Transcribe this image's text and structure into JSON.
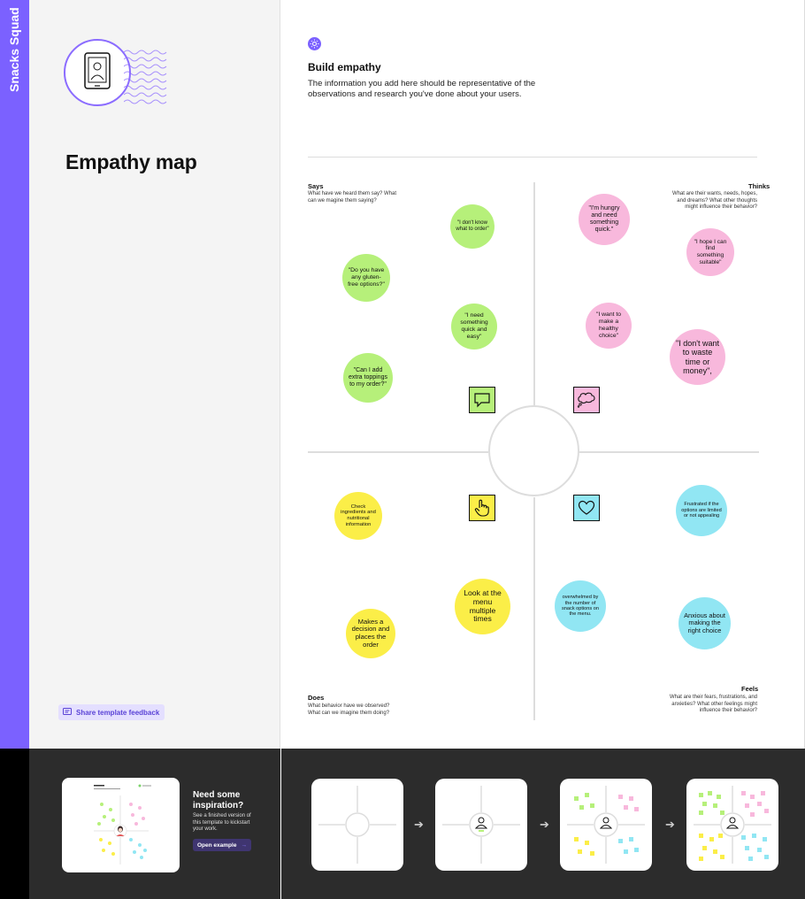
{
  "sidebar": {
    "team_name": "Snacks Squad"
  },
  "left_panel": {
    "title": "Empathy map",
    "feedback_label": "Share template feedback"
  },
  "header": {
    "title": "Build empathy",
    "description": "The information you add here should be representative of the observations and research you've done about your users."
  },
  "quadrants": {
    "says": {
      "title": "Says",
      "description": "What have we heard them say? What can we magine them saying?"
    },
    "thinks": {
      "title": "Thinks",
      "description": "What are their wants, needs, hopes, and dreams? What other thoughts might influence their behavior?"
    },
    "does": {
      "title": "Does",
      "description": "What behavior have we observed? What can we imagine them doing?"
    },
    "feels": {
      "title": "Feels",
      "description": "What are their fears, frustrations, and anxieties? What other feelings might influence their behavior?"
    }
  },
  "stickies": {
    "says": [
      "\"I don't know what to order\"",
      "\"Do you have any gluten-free options?\"",
      "\"I need something quick and easy\"",
      "\"Can I add extra toppings to my order?\""
    ],
    "thinks": [
      "\"I'm hungry and need something quick.\"",
      "\"I hope I can find something suitable\"",
      "\"I want to make a healthy choice\"",
      "\"I don't want to waste time or money\","
    ],
    "does": [
      "Check ingredients and nutritional information",
      "Look at the menu multiple times",
      "Makes a decision and places the order"
    ],
    "feels": [
      "Frustrated if the options are limited or not appealing",
      "overwhelmed by the number of snack options on the menu.",
      "Anxious about making the right choice"
    ]
  },
  "icons": {
    "says": "speech-bubble-icon",
    "thinks": "thought-bubble-icon",
    "does": "hand-pointer-icon",
    "feels": "heart-icon",
    "header": "sun-icon"
  },
  "colors": {
    "accent": "#7b61ff",
    "says": "#b6f07a",
    "thinks": "#f8b8dc",
    "does": "#fbee48",
    "feels": "#91e6f3"
  },
  "inspiration": {
    "title": "Need some inspiration?",
    "description": "See a finished version of this template to kickstart your work.",
    "button_label": "Open example"
  }
}
